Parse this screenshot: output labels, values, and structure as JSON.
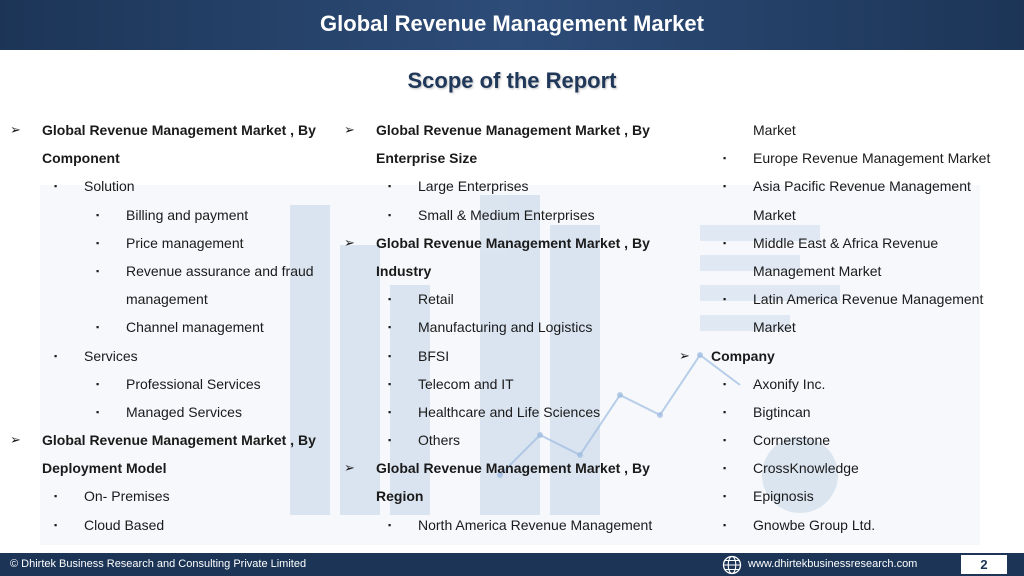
{
  "header": {
    "title": "Global Revenue Management Market"
  },
  "subtitle": "Scope of the Report",
  "col1": [
    {
      "level": 1,
      "text": "Global Revenue Management Market , By"
    },
    {
      "level": 1,
      "cont": true,
      "text": "Component"
    },
    {
      "level": 2,
      "text": "Solution"
    },
    {
      "level": 3,
      "text": "Billing and payment"
    },
    {
      "level": 3,
      "text": "Price management"
    },
    {
      "level": 3,
      "text": "Revenue assurance and fraud"
    },
    {
      "level": 3,
      "cont": true,
      "text": "management"
    },
    {
      "level": 3,
      "text": "Channel management"
    },
    {
      "level": 2,
      "text": "Services"
    },
    {
      "level": 3,
      "text": "Professional Services"
    },
    {
      "level": 3,
      "text": "Managed Services"
    },
    {
      "level": 1,
      "text": "Global Revenue Management Market , By"
    },
    {
      "level": 1,
      "cont": true,
      "text": "Deployment Model"
    },
    {
      "level": 2,
      "text": "On- Premises"
    },
    {
      "level": 2,
      "text": "Cloud Based"
    }
  ],
  "col2": [
    {
      "level": 1,
      "text": "Global Revenue Management Market , By"
    },
    {
      "level": 1,
      "cont": true,
      "text": "Enterprise Size"
    },
    {
      "level": 2,
      "text": "Large Enterprises"
    },
    {
      "level": 2,
      "text": "Small & Medium Enterprises"
    },
    {
      "level": 1,
      "text": "Global Revenue Management Market , By"
    },
    {
      "level": 1,
      "cont": true,
      "text": "Industry"
    },
    {
      "level": 2,
      "text": "Retail"
    },
    {
      "level": 2,
      "text": "Manufacturing and Logistics"
    },
    {
      "level": 2,
      "text": "BFSI"
    },
    {
      "level": 2,
      "text": "Telecom and IT"
    },
    {
      "level": 2,
      "text": "Healthcare and Life Sciences"
    },
    {
      "level": 2,
      "text": "Others"
    },
    {
      "level": 1,
      "text": "Global Revenue Management Market , By"
    },
    {
      "level": 1,
      "cont": true,
      "text": "Region"
    },
    {
      "level": 2,
      "text": "North America Revenue Management"
    }
  ],
  "col3": [
    {
      "level": 2,
      "cont": true,
      "text": "Market"
    },
    {
      "level": 2,
      "text": "Europe Revenue Management Market"
    },
    {
      "level": 2,
      "text": "Asia Pacific Revenue Management"
    },
    {
      "level": 2,
      "cont": true,
      "text": "Market"
    },
    {
      "level": 2,
      "text": "Middle East & Africa Revenue"
    },
    {
      "level": 2,
      "cont": true,
      "text": "Management Market"
    },
    {
      "level": 2,
      "text": "Latin America Revenue Management"
    },
    {
      "level": 2,
      "cont": true,
      "text": "Market"
    },
    {
      "level": 1,
      "text": "Company"
    },
    {
      "level": 2,
      "text": "Axonify Inc."
    },
    {
      "level": 2,
      "text": "Bigtincan"
    },
    {
      "level": 2,
      "text": "Cornerstone"
    },
    {
      "level": 2,
      "text": "CrossKnowledge"
    },
    {
      "level": 2,
      "text": "Epignosis"
    },
    {
      "level": 2,
      "text": "Gnowbe Group Ltd."
    }
  ],
  "markers": {
    "l1": "➢",
    "bullet": "▪"
  },
  "colors": {
    "header_bg": "#1c3557",
    "title_text": "#1f3759",
    "footer_bg": "#1c3557"
  },
  "footer": {
    "copyright": "© Dhirtek Business Research and Consulting Private Limited",
    "website": "www.dhirtekbusinessresearch.com",
    "page_number": "2",
    "globe_icon": "globe-icon"
  }
}
